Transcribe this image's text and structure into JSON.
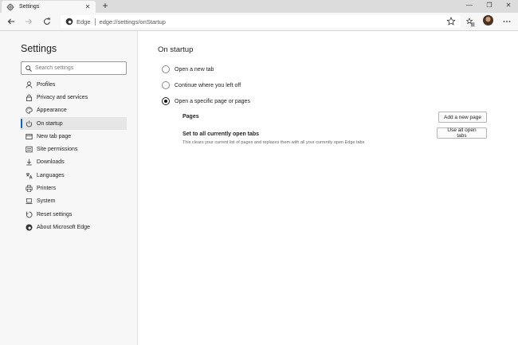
{
  "tab": {
    "title": "Settings",
    "close": "✕",
    "new_tab": "+"
  },
  "window_controls": {
    "minimize": "—",
    "maximize": "❐",
    "close": "✕"
  },
  "toolbar": {
    "site_label": "Edge",
    "url": "edge://settings/onStartup"
  },
  "sidebar": {
    "title": "Settings",
    "search_placeholder": "Search settings",
    "items": [
      {
        "label": "Profiles",
        "icon": "person-icon"
      },
      {
        "label": "Privacy and services",
        "icon": "lock-icon"
      },
      {
        "label": "Appearance",
        "icon": "palette-icon"
      },
      {
        "label": "On startup",
        "icon": "power-icon",
        "active": true
      },
      {
        "label": "New tab page",
        "icon": "new-tab-icon"
      },
      {
        "label": "Site permissions",
        "icon": "site-permissions-icon"
      },
      {
        "label": "Downloads",
        "icon": "download-icon"
      },
      {
        "label": "Languages",
        "icon": "languages-icon"
      },
      {
        "label": "Printers",
        "icon": "printer-icon"
      },
      {
        "label": "System",
        "icon": "laptop-icon"
      },
      {
        "label": "Reset settings",
        "icon": "reset-icon"
      },
      {
        "label": "About Microsoft Edge",
        "icon": "edge-icon"
      }
    ]
  },
  "main": {
    "title": "On startup",
    "options": [
      {
        "label": "Open a new tab",
        "checked": false
      },
      {
        "label": "Continue where you left off",
        "checked": false
      },
      {
        "label": "Open a specific page or pages",
        "checked": true
      }
    ],
    "pages_label": "Pages",
    "add_page_button": "Add a new page",
    "set_all_label": "Set to all currently open tabs",
    "set_all_description": "This clears your current list of pages and replaces them with all your currently open Edge tabs",
    "use_all_tabs_button": "Use all open tabs"
  },
  "colors": {
    "accent": "#0a64c2",
    "sidebar_bg": "#f7f7f7",
    "titlebar_bg": "#dcdcdc"
  }
}
